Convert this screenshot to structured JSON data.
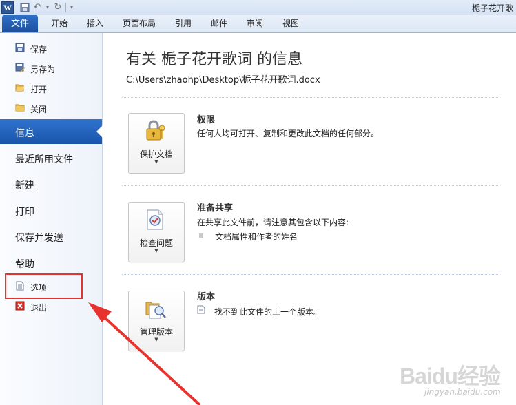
{
  "window": {
    "title": "栀子花开歌"
  },
  "quick_access": {
    "app_icon": "W",
    "items": [
      "save-icon",
      "undo-icon",
      "redo-icon",
      "customize-icon"
    ]
  },
  "ribbon": {
    "file_tab": "文件",
    "tabs": [
      "开始",
      "插入",
      "页面布局",
      "引用",
      "邮件",
      "审阅",
      "视图"
    ]
  },
  "nav": {
    "top_items": [
      {
        "label": "保存",
        "icon": "save-icon"
      },
      {
        "label": "另存为",
        "icon": "save-as-icon"
      },
      {
        "label": "打开",
        "icon": "open-folder-icon"
      },
      {
        "label": "关闭",
        "icon": "close-folder-icon"
      }
    ],
    "big_items": [
      "信息",
      "最近所用文件",
      "新建",
      "打印",
      "保存并发送",
      "帮助"
    ],
    "active": "信息",
    "bottom_items": [
      {
        "label": "选项",
        "icon": "options-icon"
      },
      {
        "label": "退出",
        "icon": "exit-icon"
      }
    ]
  },
  "info": {
    "title": "有关 栀子花开歌词 的信息",
    "path": "C:\\Users\\zhaohp\\Desktop\\栀子花开歌词.docx",
    "sections": [
      {
        "button": "保护文档",
        "title": "权限",
        "desc": "任何人均可打开、复制和更改此文档的任何部分。"
      },
      {
        "button": "检查问题",
        "title": "准备共享",
        "desc": "在共享此文件前，请注意其包含以下内容:",
        "bullet": "文档属性和作者的姓名"
      },
      {
        "button": "管理版本",
        "title": "版本",
        "desc": "找不到此文件的上一个版本。"
      }
    ]
  },
  "watermark": {
    "text": "Baidu经验",
    "sub": "jingyan.baidu.com"
  },
  "colors": {
    "accent": "#1c5bb4",
    "annotation": "#e8322e"
  }
}
